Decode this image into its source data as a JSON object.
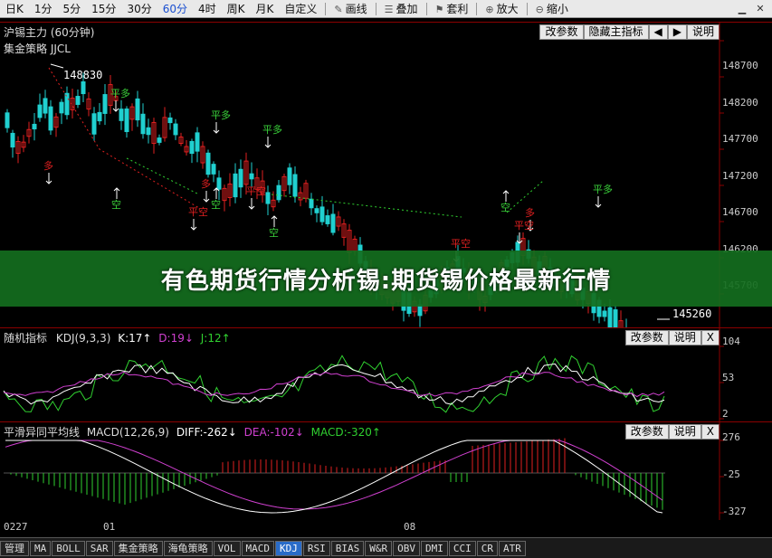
{
  "toolbar": {
    "periods": [
      "日K",
      "1分",
      "5分",
      "15分",
      "30分",
      "60分",
      "4时",
      "周K",
      "月K",
      "自定义"
    ],
    "active_period": "60分",
    "tools": [
      {
        "icon": "pencil-icon",
        "glyph": "✎",
        "label": "画线"
      },
      {
        "icon": "layers-icon",
        "glyph": "☰",
        "label": "叠加"
      },
      {
        "icon": "flag-icon",
        "glyph": "⚑",
        "label": "套利"
      },
      {
        "icon": "zoom-in-icon",
        "glyph": "⊕",
        "label": "放大"
      },
      {
        "icon": "zoom-out-icon",
        "glyph": "⊖",
        "label": "缩小"
      }
    ]
  },
  "main_panel": {
    "title": "沪锡主力 (60分钟)",
    "strategy": "集金策略 JJCL",
    "btn_params": "改参数",
    "btn_hide": "隐藏主指标",
    "btn_prev": "◀",
    "btn_next": "▶",
    "btn_help": "说明",
    "high_label": "148830",
    "low_label": "145260",
    "y_ticks": [
      "148700",
      "148200",
      "147700",
      "147200",
      "146700",
      "146200",
      "145700"
    ],
    "signals": [
      {
        "text": "平多",
        "color": "#3ad13a"
      },
      {
        "text": "平多",
        "color": "#3ad13a"
      },
      {
        "text": "平多",
        "color": "#3ad13a"
      },
      {
        "text": "平多",
        "color": "#3ad13a"
      },
      {
        "text": "空",
        "color": "#3ad13a"
      },
      {
        "text": "空",
        "color": "#3ad13a"
      },
      {
        "text": "空",
        "color": "#3ad13a"
      },
      {
        "text": "空",
        "color": "#3ad13a"
      },
      {
        "text": "多",
        "color": "#e02020"
      },
      {
        "text": "多",
        "color": "#e02020"
      },
      {
        "text": "多",
        "color": "#e02020"
      },
      {
        "text": "平空",
        "color": "#e02020"
      },
      {
        "text": "平空",
        "color": "#e02020"
      },
      {
        "text": "平空",
        "color": "#e02020"
      },
      {
        "text": "平空",
        "color": "#e02020"
      }
    ]
  },
  "banner": {
    "text": "有色期货行情分析锡:期货锡价格最新行情"
  },
  "kdj_panel": {
    "title": "随机指标",
    "params": "KDJ(9,3,3)",
    "k": "K:17↑",
    "d": "D:19↓",
    "j": "J:12↑",
    "btn_params": "改参数",
    "btn_help": "说明",
    "btn_close": "X",
    "y_ticks": [
      "104",
      "53",
      "2"
    ]
  },
  "macd_panel": {
    "title": "平滑异同平均线",
    "params": "MACD(12,26,9)",
    "diff": "DIFF:-262↓",
    "dea": "DEA:-102↓",
    "macd": "MACD:-320↑",
    "btn_params": "改参数",
    "btn_help": "说明",
    "btn_close": "X",
    "y_ticks": [
      "276",
      "-25",
      "-327"
    ]
  },
  "x_axis": {
    "labels": [
      "0227",
      "01",
      "08"
    ]
  },
  "bottom_tabs": [
    {
      "label": "管理",
      "cn": true
    },
    {
      "label": "MA",
      "cn": false
    },
    {
      "label": "BOLL",
      "cn": false
    },
    {
      "label": "SAR",
      "cn": false
    },
    {
      "label": "集金策略",
      "cn": true
    },
    {
      "label": "海龟策略",
      "cn": true
    },
    {
      "label": "VOL",
      "cn": false
    },
    {
      "label": "MACD",
      "cn": false
    },
    {
      "label": "KDJ",
      "cn": false,
      "active": true
    },
    {
      "label": "RSI",
      "cn": false
    },
    {
      "label": "BIAS",
      "cn": false
    },
    {
      "label": "W&R",
      "cn": false
    },
    {
      "label": "OBV",
      "cn": false
    },
    {
      "label": "DMI",
      "cn": false
    },
    {
      "label": "CCI",
      "cn": false
    },
    {
      "label": "CR",
      "cn": false
    },
    {
      "label": "ATR",
      "cn": false
    }
  ],
  "colors": {
    "up": "#e02020",
    "down": "#20d0d0",
    "kline": "#ffffff",
    "dline": "#d040d0",
    "jline": "#30d030",
    "grid": "#8b0000"
  }
}
